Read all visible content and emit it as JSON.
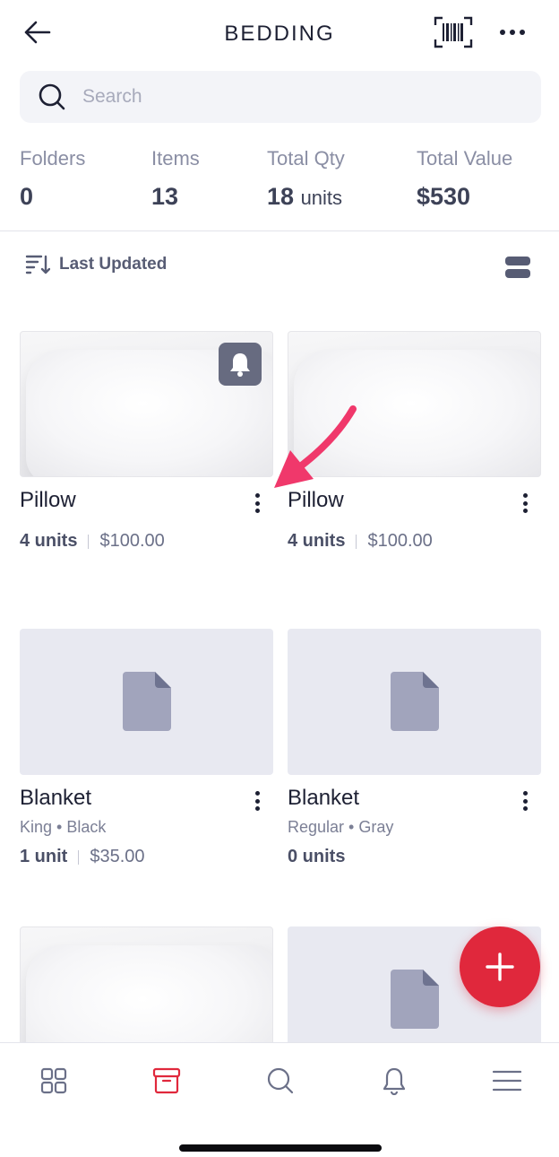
{
  "header": {
    "title": "BEDDING",
    "back_icon": "arrow-left-icon",
    "barcode_icon": "barcode-scan-icon",
    "more_icon": "more-horizontal-icon"
  },
  "search": {
    "placeholder": "Search",
    "icon": "search-icon"
  },
  "stats": [
    {
      "label": "Folders",
      "value": "0",
      "unit": ""
    },
    {
      "label": "Items",
      "value": "13",
      "unit": ""
    },
    {
      "label": "Total Qty",
      "value": "18",
      "unit": "units"
    },
    {
      "label": "Total Value",
      "value": "$530",
      "unit": ""
    }
  ],
  "sort": {
    "label": "Last Updated",
    "icon": "sort-descending-icon",
    "view_icon": "list-view-icon"
  },
  "items": [
    {
      "name": "Pillow",
      "variant": "",
      "qty": "4 units",
      "price": "$100.00",
      "image": "pillow-photo",
      "alert": true
    },
    {
      "name": "Pillow",
      "variant": "",
      "qty": "4 units",
      "price": "$100.00",
      "image": "pillow-photo",
      "alert": false
    },
    {
      "name": "Blanket",
      "variant": "King • Black",
      "qty": "1 unit",
      "price": "$35.00",
      "image": "document-placeholder",
      "alert": false
    },
    {
      "name": "Blanket",
      "variant": "Regular • Gray",
      "qty": "0 units",
      "price": "",
      "image": "document-placeholder",
      "alert": false
    },
    {
      "name": "",
      "variant": "",
      "qty": "",
      "price": "",
      "image": "pillow-photo",
      "alert": false
    },
    {
      "name": "",
      "variant": "",
      "qty": "",
      "price": "",
      "image": "document-placeholder",
      "alert": false
    }
  ],
  "fab": {
    "icon": "plus-icon"
  },
  "bottom_nav": [
    {
      "name": "dashboard",
      "icon": "grid-icon",
      "active": false
    },
    {
      "name": "items",
      "icon": "box-icon",
      "active": true
    },
    {
      "name": "search",
      "icon": "search-icon",
      "active": false
    },
    {
      "name": "notifications",
      "icon": "bell-icon",
      "active": false
    },
    {
      "name": "menu",
      "icon": "hamburger-menu-icon",
      "active": false
    }
  ],
  "colors": {
    "accent": "#e0283c",
    "text_primary": "#1d2033",
    "text_secondary": "#8a8ea4",
    "placeholder_bg": "#e8e9f1",
    "annotation_arrow": "#f0386b"
  }
}
